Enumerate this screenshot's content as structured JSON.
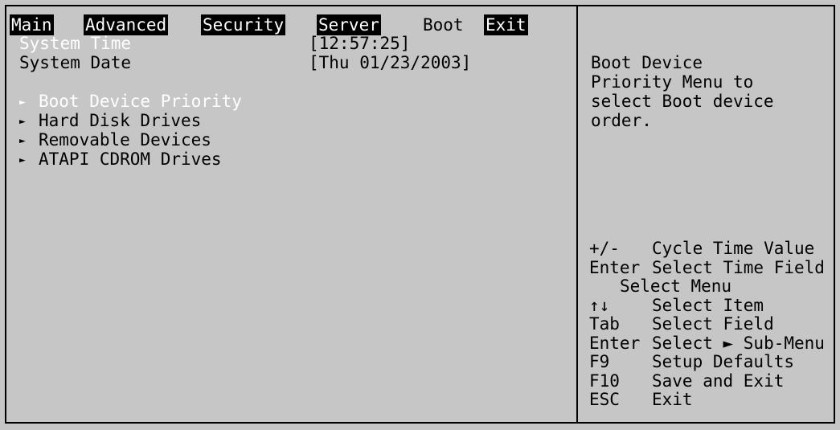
{
  "menu": {
    "tabs": [
      {
        "label": "Main",
        "active": false
      },
      {
        "label": "Advanced",
        "active": false
      },
      {
        "label": "Security",
        "active": false
      },
      {
        "label": "Server",
        "active": false
      },
      {
        "label": "Boot",
        "active": true
      },
      {
        "label": "Exit",
        "active": false
      }
    ]
  },
  "fields": {
    "system_time": {
      "label": "System Time",
      "value": "[12:57:25]"
    },
    "system_date": {
      "label": "System Date",
      "value": "[Thu 01/23/2003]"
    }
  },
  "submenus": [
    {
      "label": "Boot Device Priority",
      "selected": true
    },
    {
      "label": "Hard Disk Drives",
      "selected": false
    },
    {
      "label": "Removable Devices",
      "selected": false
    },
    {
      "label": "ATAPI CDROM Drives",
      "selected": false
    }
  ],
  "help": {
    "text": "Boot Device\nPriority Menu to\nselect Boot device\norder."
  },
  "keys": [
    {
      "key": "+/-",
      "desc": "Cycle Time Value"
    },
    {
      "key": "Enter",
      "desc": "Select Time Field"
    },
    {
      "key": "",
      "desc": "Select Menu"
    },
    {
      "key": "↑↓",
      "desc": "Select Item"
    },
    {
      "key": "Tab",
      "desc": "Select Field"
    },
    {
      "key": "Enter",
      "desc": "Select ► Sub-Menu"
    },
    {
      "key": "F9",
      "desc": "Setup Defaults"
    },
    {
      "key": "F10",
      "desc": "Save and Exit"
    },
    {
      "key": "ESC",
      "desc": "Exit"
    }
  ],
  "icons": {
    "submenu_arrow": "right-triangle-icon"
  },
  "colors": {
    "background": "#c6c6c6",
    "text": "#000000",
    "highlight_text": "#ffffff",
    "menu_inactive_bg": "#000000"
  }
}
